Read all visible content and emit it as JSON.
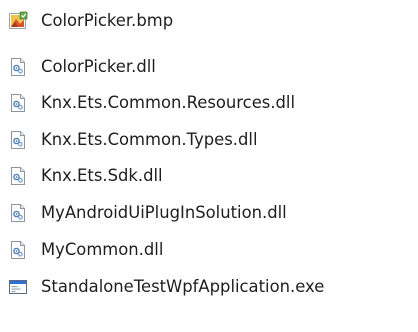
{
  "files": [
    {
      "name": "ColorPicker.bmp",
      "icon": "bitmap-image-icon"
    },
    {
      "name": "ColorPicker.dll",
      "icon": "dll-file-icon"
    },
    {
      "name": "Knx.Ets.Common.Resources.dll",
      "icon": "dll-file-icon"
    },
    {
      "name": "Knx.Ets.Common.Types.dll",
      "icon": "dll-file-icon"
    },
    {
      "name": "Knx.Ets.Sdk.dll",
      "icon": "dll-file-icon"
    },
    {
      "name": "MyAndroidUiPlugInSolution.dll",
      "icon": "dll-file-icon"
    },
    {
      "name": "MyCommon.dll",
      "icon": "dll-file-icon"
    },
    {
      "name": "StandaloneTestWpfApplication.exe",
      "icon": "exe-application-icon"
    }
  ],
  "colors": {
    "text": "#1e1e1e",
    "background": "#ffffff",
    "exe_titlebar": "#2f6fd6"
  }
}
